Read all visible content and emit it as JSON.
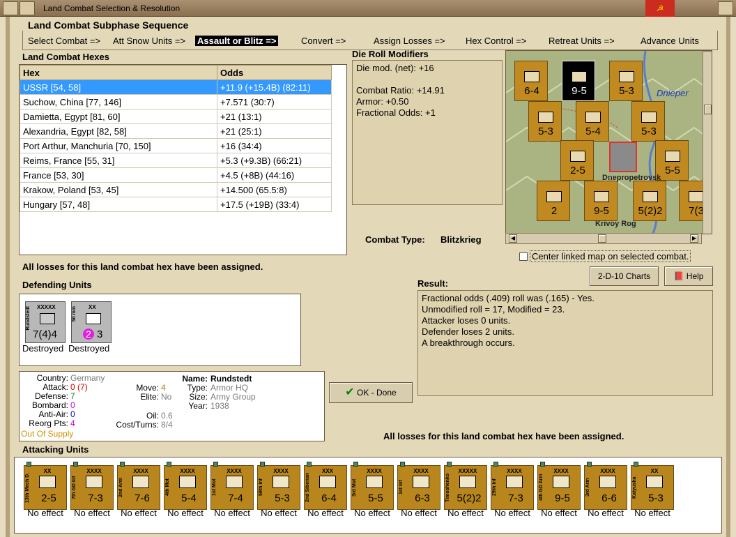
{
  "window": {
    "title": "Land Combat Selection & Resolution"
  },
  "subphase": {
    "title": "Land Combat Subphase Sequence",
    "steps": [
      "Select Combat =>",
      "Att Snow Units =>",
      "Assault or Blitz =>",
      "Convert =>",
      "Assign Losses =>",
      "Hex Control =>",
      "Retreat Units =>",
      "Advance Units"
    ],
    "selected_index": 2
  },
  "hexes": {
    "title": "Land Combat Hexes",
    "col_hex": "Hex",
    "col_odds": "Odds",
    "rows": [
      {
        "hex": "USSR [54, 58]",
        "odds": "+11.9 (+15.4B) (82:11)"
      },
      {
        "hex": "Suchow, China [77, 146]",
        "odds": "+7.571 (30:7)"
      },
      {
        "hex": "Damietta, Egypt [81, 60]",
        "odds": "+21 (13:1)"
      },
      {
        "hex": "Alexandria, Egypt [82, 58]",
        "odds": "+21 (25:1)"
      },
      {
        "hex": "Port Arthur, Manchuria [70, 150]",
        "odds": "+16 (34:4)"
      },
      {
        "hex": "Reims, France [55, 31]",
        "odds": "+5.3 (+9.3B) (66:21)"
      },
      {
        "hex": "France [53, 30]",
        "odds": "+4.5 (+8B) (44:16)"
      },
      {
        "hex": "Krakow, Poland [53, 45]",
        "odds": "+14.500 (65.5:8)"
      },
      {
        "hex": "Hungary [57, 48]",
        "odds": "+17.5 (+19B) (33:4)"
      }
    ]
  },
  "modifiers": {
    "title": "Die Roll Modifiers",
    "net": "Die mod. (net): +16",
    "ratio": "Combat Ratio: +14.91",
    "armor": "Armor: +0.50",
    "frac": "Fractional Odds: +1"
  },
  "combat_type": {
    "label": "Combat Type:",
    "value": "Blitzkrieg"
  },
  "map": {
    "labels": {
      "dnieper": "Dnieper",
      "krivoy": "Krivoy Rog",
      "dnepr": "Dnepropetrovsk"
    },
    "center_label": "Center linked map on selected combat."
  },
  "losses_msg": "All losses for this land combat hex have been assigned.",
  "defending": {
    "title": "Defending Units",
    "units": [
      {
        "size": "XXXXX",
        "name": "Rundstedt",
        "value": "7(4)4",
        "status": "Destroyed"
      },
      {
        "size": "XX",
        "name": "50 mm",
        "value_a": "2",
        "value_b": "3",
        "status": "Destroyed"
      }
    ]
  },
  "details": {
    "country_l": "Country:",
    "country": "Germany",
    "attack_l": "Attack:",
    "attack_a": "0",
    "attack_b": "(7)",
    "defense_l": "Defense:",
    "defense": "7",
    "bombard_l": "Bombard:",
    "bombard": "0",
    "antiair_l": "Anti-Air:",
    "antiair": "0",
    "reorg_l": "Reorg Pts:",
    "reorg": "4",
    "supply": "Out Of Supply",
    "move_l": "Move:",
    "move": "4",
    "elite_l": "Elite:",
    "elite": "No",
    "oil_l": "Oil:",
    "oil": "0.6",
    "cost_l": "Cost/Turns:",
    "cost": "8/4",
    "name_l": "Name:",
    "name": "Rundstedt",
    "type_l": "Type:",
    "type": "Armor HQ",
    "size_l": "Size:",
    "size": "Army Group",
    "year_l": "Year:",
    "year": "1938"
  },
  "buttons": {
    "charts": "2-D-10 Charts",
    "help": "Help",
    "ok": "OK - Done"
  },
  "result": {
    "title": "Result:",
    "lines": [
      "Fractional odds (.409) roll was (.165)  - Yes.",
      "Unmodified roll = 17, Modified = 23.",
      "Attacker loses 0 units.",
      "Defender loses 2 units.",
      "A breakthrough occurs."
    ]
  },
  "attacking": {
    "title": "Attacking Units",
    "units": [
      {
        "name": "13th Mech D.",
        "size": "XX",
        "value": "2-5",
        "status": "No effect"
      },
      {
        "name": "7th GD Inf",
        "size": "XXXX",
        "value": "7-3",
        "status": "No effect"
      },
      {
        "name": "2nd Arm",
        "size": "XXXX",
        "value": "7-6",
        "status": "No effect"
      },
      {
        "name": "4th Mot",
        "size": "XXXX",
        "value": "5-4",
        "status": "No effect"
      },
      {
        "name": "1st Mot",
        "size": "XXXX",
        "value": "7-4",
        "status": "No effect"
      },
      {
        "name": "59th Inf",
        "size": "XXXX",
        "value": "5-3",
        "status": "No effect"
      },
      {
        "name": "2nd Siberian",
        "size": "XXX",
        "value": "6-4",
        "status": "No effect"
      },
      {
        "name": "3rd Mot",
        "size": "XXXX",
        "value": "5-5",
        "status": "No effect"
      },
      {
        "name": "1st Inf",
        "size": "XXXX",
        "value": "6-3",
        "status": "No effect"
      },
      {
        "name": "Timoshenko",
        "size": "XXXXX",
        "value": "5(2)2",
        "status": "No effect"
      },
      {
        "name": "29th Inf",
        "size": "XXXX",
        "value": "7-3",
        "status": "No effect"
      },
      {
        "name": "4th GD Arm",
        "size": "XXXX",
        "value": "9-5",
        "status": "No effect"
      },
      {
        "name": "3rd Arm",
        "size": "XXXX",
        "value": "6-6",
        "status": "No effect"
      },
      {
        "name": "Katyusha",
        "size": "XX",
        "value": "5-3",
        "status": "No effect"
      }
    ]
  }
}
